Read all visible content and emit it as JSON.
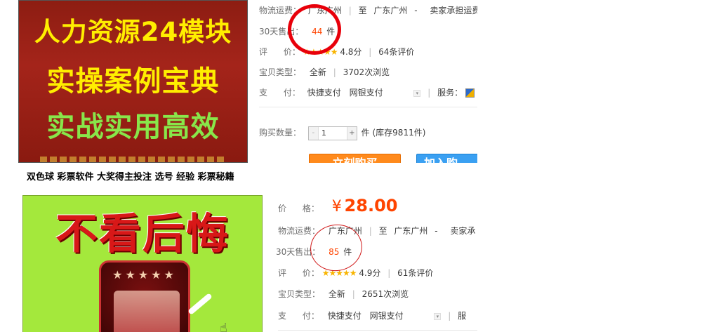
{
  "listing1": {
    "image_lines": [
      "人力资源24模块",
      "实操案例宝典",
      "实战实用高效"
    ],
    "shipping_label": "物流运费：",
    "shipping_from": "广东广州",
    "shipping_to_prefix": "至",
    "shipping_to": "广东广州",
    "shipping_dash": "-",
    "shipping_note": "卖家承担运费",
    "sales_label": "30天售出：",
    "sales_count": "44",
    "sales_unit": "件",
    "rating_label": "评      价：",
    "rating_stars": "★★★★★",
    "rating_score": "4.8分",
    "rating_count": "64条评价",
    "condition_label": "宝贝类型：",
    "condition": "全新",
    "views": "3702次浏览",
    "payment_label": "支      付：",
    "payment_1": "快捷支付",
    "payment_2": "网银支付",
    "service_label": "服务：",
    "qty_label": "购买数量：",
    "qty_minus": "-",
    "qty_value": "1",
    "qty_plus": "+",
    "qty_unit": "件 (库存9811件)",
    "buy_button": "立刻购买",
    "cart_button": "加入购"
  },
  "listing2": {
    "title": "双色球 彩票软件 大奖得主投注 选号 经验 彩票秘籍",
    "image_text": "不看后悔",
    "image_stars": "★★★★★",
    "price_label": "价      格：",
    "currency": "¥",
    "price": "28.00",
    "shipping_label": "物流运费：",
    "shipping_from": "广东广州",
    "shipping_to_prefix": "至",
    "shipping_to": "广东广州",
    "shipping_dash": "-",
    "shipping_note": "卖家承",
    "sales_label": "30天售出：",
    "sales_count": "85",
    "sales_unit": "件",
    "rating_label": "评      价：",
    "rating_stars": "★★★★★",
    "rating_score": "4.9分",
    "rating_count": "61条评价",
    "condition_label": "宝贝类型：",
    "condition": "全新",
    "views": "2651次浏览",
    "payment_label": "支      付：",
    "payment_1": "快捷支付",
    "payment_2": "网银支付",
    "service_label": "服"
  },
  "colors": {
    "accent_orange": "#ff4400",
    "buy_button": "#ff8a1c",
    "cart_button": "#3aa0f2",
    "star": "#f8b400",
    "annotation_red": "#e8000a"
  }
}
